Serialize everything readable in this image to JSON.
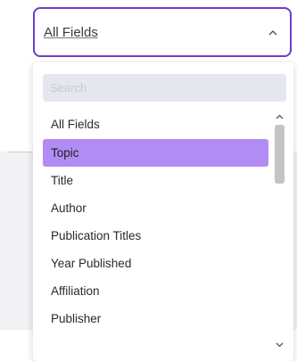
{
  "select": {
    "value": "All Fields",
    "chevron": "⌃"
  },
  "dropdown": {
    "search_placeholder": "Search",
    "items": [
      {
        "label": "All Fields"
      },
      {
        "label": "Topic",
        "selected": true
      },
      {
        "label": "Title"
      },
      {
        "label": "Author"
      },
      {
        "label": "Publication Titles"
      },
      {
        "label": "Year Published"
      },
      {
        "label": "Affiliation"
      },
      {
        "label": "Publisher"
      }
    ],
    "scroll_up_icon": "^",
    "scroll_down_icon": "v",
    "accent_color": "#6a3fc9",
    "selected_color": "#b28cf5"
  }
}
